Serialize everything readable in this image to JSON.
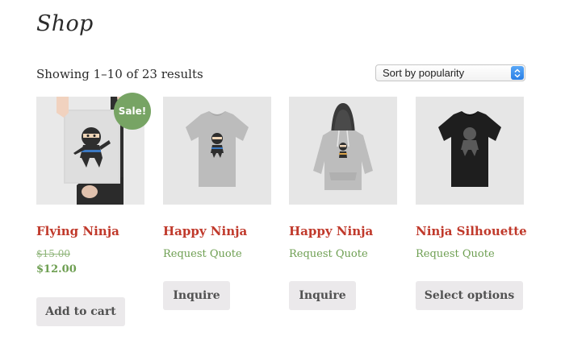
{
  "page": {
    "title": "Shop"
  },
  "toolbar": {
    "result_count": "Showing 1–10 of 23 results",
    "sort": {
      "selected": "Sort by popularity"
    }
  },
  "colors": {
    "accent": "#c0392b",
    "sale": "#77a464",
    "price": "#6e9f52",
    "button_bg": "#ebe9eb"
  },
  "products": [
    {
      "title": "Flying Ninja",
      "sale_badge": "Sale!",
      "old_price": "$15.00",
      "price": "$12.00",
      "button": "Add to cart",
      "image": "ninja-poster"
    },
    {
      "title": "Happy Ninja",
      "quote": "Request Quote",
      "button": "Inquire",
      "image": "grey-tshirt"
    },
    {
      "title": "Happy Ninja",
      "quote": "Request Quote",
      "button": "Inquire",
      "image": "grey-hoodie"
    },
    {
      "title": "Ninja Silhouette",
      "quote": "Request Quote",
      "button": "Select options",
      "image": "black-tshirt"
    }
  ]
}
